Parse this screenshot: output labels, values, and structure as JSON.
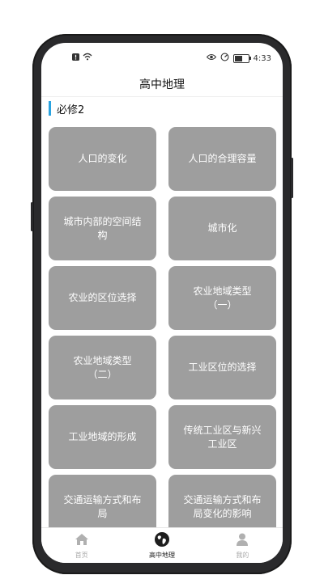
{
  "status_bar": {
    "time": "4:33",
    "battery_level": 0.6,
    "icons_left": [
      "alert-icon",
      "wifi-icon"
    ],
    "icons_right": [
      "eye-icon",
      "gauge-icon",
      "battery-icon"
    ]
  },
  "header": {
    "title": "高中地理"
  },
  "section": {
    "title": "必修2",
    "accent_color": "#29a3e0"
  },
  "cards": [
    {
      "label": "人口的变化"
    },
    {
      "label": "人口的合理容量"
    },
    {
      "label": "城市内部的空间结构"
    },
    {
      "label": "城市化"
    },
    {
      "label": "农业的区位选择"
    },
    {
      "label": "农业地域类型（一）"
    },
    {
      "label": "农业地域类型（二）"
    },
    {
      "label": "工业区位的选择"
    },
    {
      "label": "工业地域的形成"
    },
    {
      "label": "传统工业区与新兴工业区"
    },
    {
      "label": "交通运输方式和布局"
    },
    {
      "label": "交通运输方式和布局变化的影响"
    }
  ],
  "tabbar": {
    "tabs": [
      {
        "label": "首页",
        "icon": "home-icon",
        "active": false
      },
      {
        "label": "高中地理",
        "icon": "globe-icon",
        "active": true
      },
      {
        "label": "我的",
        "icon": "person-icon",
        "active": false
      }
    ]
  },
  "colors": {
    "card_bg": "#9e9e9e",
    "card_text": "#ffffff",
    "active_tab": "#222222",
    "inactive_tab": "#aaaaaa"
  }
}
